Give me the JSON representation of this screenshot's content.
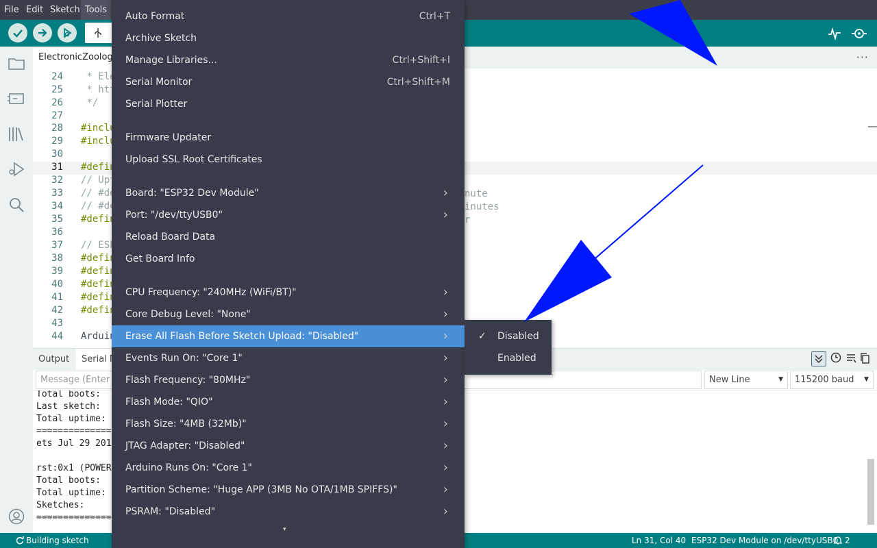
{
  "menubar": {
    "items": [
      {
        "label": "File"
      },
      {
        "label": "Edit"
      },
      {
        "label": "Sketch"
      },
      {
        "label": "Tools"
      }
    ]
  },
  "tabs": {
    "main": "ElectronicZoology"
  },
  "editor": {
    "lines": [
      {
        "n": "24",
        "text": " * Ele"
      },
      {
        "n": "25",
        "text": " * htt"
      },
      {
        "n": "26",
        "text": " */"
      },
      {
        "n": "27",
        "text": ""
      },
      {
        "n": "28",
        "text": "#inclu"
      },
      {
        "n": "29",
        "text": "#inclu"
      },
      {
        "n": "30",
        "text": ""
      },
      {
        "n": "31",
        "text": "#defin"
      },
      {
        "n": "32",
        "text": "// Upt"
      },
      {
        "n": "33",
        "text": "// #de"
      },
      {
        "n": "34",
        "text": "// #de"
      },
      {
        "n": "35",
        "text": "#defin"
      },
      {
        "n": "36",
        "text": ""
      },
      {
        "n": "37",
        "text": "// ESP"
      },
      {
        "n": "38",
        "text": "#defin"
      },
      {
        "n": "39",
        "text": "#defin"
      },
      {
        "n": "40",
        "text": "#defin"
      },
      {
        "n": "41",
        "text": "#defin"
      },
      {
        "n": "42",
        "text": "#defin"
      },
      {
        "n": "43",
        "text": ""
      },
      {
        "n": "44",
        "text": "Arduin"
      }
    ],
    "tails": {
      "l33": "nute",
      "l34": "inutes",
      "l35": "r"
    }
  },
  "panel": {
    "tab_output": "Output",
    "tab_serial": "Serial M",
    "message_placeholder": "Message (Enter t",
    "line_ending": "New Line",
    "baud": "115200 baud",
    "lines": [
      "Total boots:",
      "Last sketch:",
      "Total uptime:",
      "==============",
      "ets Jul 29 201",
      "",
      "rst:0x1 (POWER",
      "Total boots:",
      "Total uptime:",
      "Sketches:",
      "=============="
    ]
  },
  "tools_menu": {
    "items": [
      {
        "label": "Auto Format",
        "shortcut": "Ctrl+T"
      },
      {
        "label": "Archive Sketch",
        "shortcut": ""
      },
      {
        "label": "Manage Libraries...",
        "shortcut": "Ctrl+Shift+I"
      },
      {
        "label": "Serial Monitor",
        "shortcut": "Ctrl+Shift+M"
      },
      {
        "label": "Serial Plotter",
        "shortcut": ""
      },
      {
        "label": "Firmware Updater",
        "shortcut": ""
      },
      {
        "label": "Upload SSL Root Certificates",
        "shortcut": ""
      },
      {
        "label": "Board: \"ESP32 Dev Module\"",
        "submenu": true
      },
      {
        "label": "Port: \"/dev/ttyUSB0\"",
        "submenu": true
      },
      {
        "label": "Reload Board Data",
        "shortcut": ""
      },
      {
        "label": "Get Board Info",
        "shortcut": ""
      },
      {
        "label": "CPU Frequency: \"240MHz (WiFi/BT)\"",
        "submenu": true
      },
      {
        "label": "Core Debug Level: \"None\"",
        "submenu": true
      },
      {
        "label": "Erase All Flash Before Sketch Upload: \"Disabled\"",
        "submenu": true,
        "highlighted": true
      },
      {
        "label": "Events Run On: \"Core 1\"",
        "submenu": true
      },
      {
        "label": "Flash Frequency: \"80MHz\"",
        "submenu": true
      },
      {
        "label": "Flash Mode: \"QIO\"",
        "submenu": true
      },
      {
        "label": "Flash Size: \"4MB (32Mb)\"",
        "submenu": true
      },
      {
        "label": "JTAG Adapter: \"Disabled\"",
        "submenu": true
      },
      {
        "label": "Arduino Runs On: \"Core 1\"",
        "submenu": true
      },
      {
        "label": "Partition Scheme: \"Huge APP (3MB No OTA/1MB SPIFFS)\"",
        "submenu": true
      },
      {
        "label": "PSRAM: \"Disabled\"",
        "submenu": true
      }
    ]
  },
  "submenu": {
    "items": [
      {
        "label": "Disabled",
        "checked": true
      },
      {
        "label": "Enabled",
        "checked": false
      }
    ]
  },
  "statusbar": {
    "left": "Building sketch",
    "position": "Ln 31, Col 40",
    "board": "ESP32 Dev Module on /dev/ttyUSB0",
    "notifications": "2"
  },
  "colors": {
    "accent": "#017f82",
    "menu_bg": "#383c4a",
    "menu_highlight": "#4a90d9",
    "annotation_arrow": "#0018ff"
  }
}
